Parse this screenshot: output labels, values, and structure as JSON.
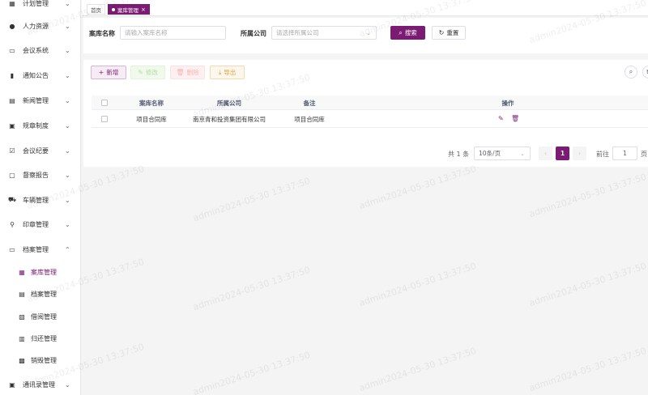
{
  "sidebar": {
    "items": [
      {
        "label": "计划管理",
        "icon": "calendar-icon"
      },
      {
        "label": "人力资源",
        "icon": "user-icon"
      },
      {
        "label": "会议系统",
        "icon": "monitor-icon"
      },
      {
        "label": "通知公告",
        "icon": "notice-icon"
      },
      {
        "label": "新闻管理",
        "icon": "news-icon"
      },
      {
        "label": "规章制度",
        "icon": "rules-icon"
      },
      {
        "label": "会议纪要",
        "icon": "minutes-icon"
      },
      {
        "label": "督察报告",
        "icon": "report-icon"
      },
      {
        "label": "车辆管理",
        "icon": "car-icon"
      },
      {
        "label": "印章管理",
        "icon": "seal-icon"
      },
      {
        "label": "档案管理",
        "icon": "folder-icon"
      },
      {
        "label": "通讯录管理",
        "icon": "contacts-icon"
      }
    ],
    "sub_items": [
      {
        "label": "案库管理",
        "icon": "archive-box-icon"
      },
      {
        "label": "档案管理",
        "icon": "file-icon"
      },
      {
        "label": "借阅管理",
        "icon": "borrow-icon"
      },
      {
        "label": "归还管理",
        "icon": "return-icon"
      },
      {
        "label": "销毁管理",
        "icon": "shredder-icon"
      }
    ]
  },
  "tabs": [
    {
      "label": "首页"
    },
    {
      "label": "案库管理",
      "close": "×"
    }
  ],
  "search": {
    "name_label": "案库名称",
    "name_placeholder": "请输入案库名称",
    "company_label": "所属公司",
    "company_placeholder": "请选择所属公司",
    "search_button": "搜索",
    "reset_button": "重置"
  },
  "toolbar": {
    "add": "新增",
    "edit": "修改",
    "delete": "删除",
    "export": "导出"
  },
  "table": {
    "columns": [
      "案库名称",
      "所属公司",
      "备注",
      "操作"
    ],
    "rows": [
      {
        "name": "项目合同库",
        "company": "南京青和投资集团有限公司",
        "remark": "项目合同库"
      }
    ]
  },
  "pagination": {
    "total": "共 1 条",
    "page_size": "10条/页",
    "current_page": "1",
    "goto_label": "前往",
    "goto_value": "1",
    "page_suffix": "页",
    "prev": "‹",
    "next": "›"
  },
  "watermark": "admin2024-05-30 13:37:50",
  "colors": {
    "accent": "#7b1b73"
  }
}
